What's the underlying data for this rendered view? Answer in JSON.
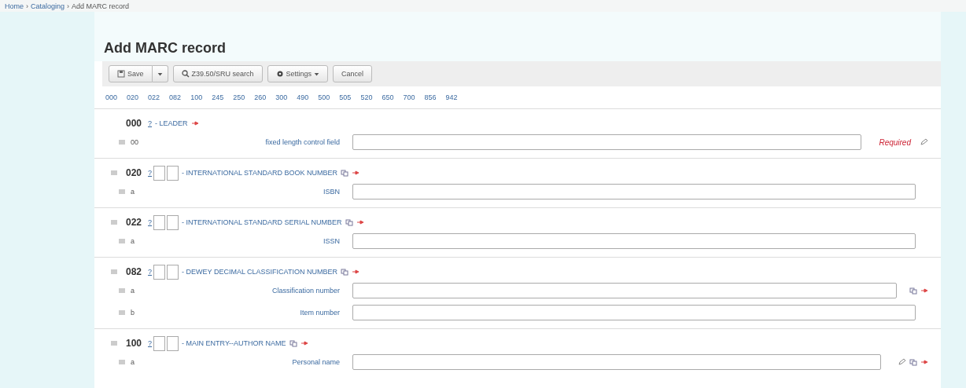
{
  "breadcrumb": [
    {
      "label": "Home",
      "kind": "link"
    },
    {
      "label": "Cataloging",
      "kind": "link"
    },
    {
      "label": "Add MARC record",
      "kind": "text"
    }
  ],
  "separator": "›",
  "title": "Add MARC record",
  "toolbar": [
    {
      "kind": "split",
      "label": "Save"
    },
    {
      "kind": "search",
      "label": "Z39.50/SRU search"
    },
    {
      "kind": "dropdown",
      "label": "Settings"
    },
    {
      "kind": "plain",
      "label": "Cancel"
    }
  ],
  "tags": [
    "000",
    "020",
    "022",
    "082",
    "100",
    "245",
    "250",
    "260",
    "300",
    "490",
    "500",
    "505",
    "520",
    "650",
    "700",
    "856",
    "942"
  ],
  "fields": [
    {
      "tag": "000",
      "help": "?",
      "indicators": false,
      "title": "- LEADER",
      "repeatable": false,
      "subfields": [
        {
          "code": "00",
          "label": "fixed length control field",
          "kind": "required",
          "required": "Required"
        }
      ]
    },
    {
      "tag": "020",
      "help": "?",
      "indicators": true,
      "title": "- INTERNATIONAL STANDARD BOOK NUMBER",
      "repeatable": true,
      "subfields": [
        {
          "code": "a",
          "label": "ISBN",
          "kind": "plain"
        }
      ]
    },
    {
      "tag": "022",
      "help": "?",
      "indicators": true,
      "title": "- INTERNATIONAL STANDARD SERIAL NUMBER",
      "repeatable": true,
      "subfields": [
        {
          "code": "a",
          "label": "ISSN",
          "kind": "plain"
        }
      ]
    },
    {
      "tag": "082",
      "help": "?",
      "indicators": true,
      "title": "- DEWEY DECIMAL CLASSIFICATION NUMBER",
      "repeatable": true,
      "subfields": [
        {
          "code": "a",
          "label": "Classification number",
          "kind": "repeatable"
        },
        {
          "code": "b",
          "label": "Item number",
          "kind": "plain"
        }
      ]
    },
    {
      "tag": "100",
      "help": "?",
      "indicators": true,
      "title": "- MAIN ENTRY--AUTHOR NAME",
      "repeatable": true,
      "subfields": [
        {
          "code": "a",
          "label": "Personal name",
          "kind": "authority"
        }
      ]
    }
  ]
}
